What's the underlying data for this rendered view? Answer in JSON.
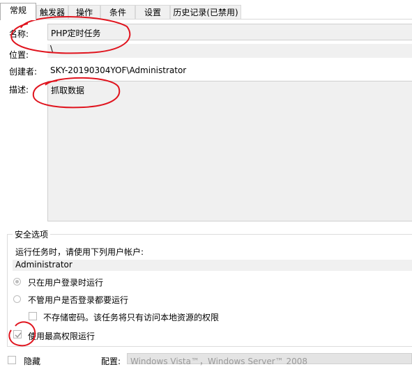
{
  "tabs": [
    {
      "label": "常规",
      "active": true
    },
    {
      "label": "触发器",
      "active": false
    },
    {
      "label": "操作",
      "active": false
    },
    {
      "label": "条件",
      "active": false
    },
    {
      "label": "设置",
      "active": false
    },
    {
      "label": "历史记录(已禁用)",
      "active": false
    }
  ],
  "general": {
    "name_label": "名称:",
    "name_value": "PHP定时任务",
    "location_label": "位置:",
    "location_value": "\\",
    "author_label": "创建者:",
    "author_value": "SKY-20190304YOF\\Administrator",
    "description_label": "描述:",
    "description_value": "抓取数据"
  },
  "security": {
    "title": "安全选项",
    "run_as_text": "运行任务时，请使用下列用户帐户:",
    "account": "Administrator",
    "radio_logged_on": "只在用户登录时运行",
    "radio_whether_logged_on": "不管用户是否登录都要运行",
    "check_no_password": "不存储密码。该任务将只有访问本地资源的权限",
    "check_highest_privileges": "使用最高权限运行",
    "highest_privileges_checked": true
  },
  "footer": {
    "hidden_label": "隐藏",
    "config_label": "配置:",
    "config_value": "Windows Vista™，Windows Server™ 2008"
  },
  "colors": {
    "annotation": "#e0141e"
  }
}
